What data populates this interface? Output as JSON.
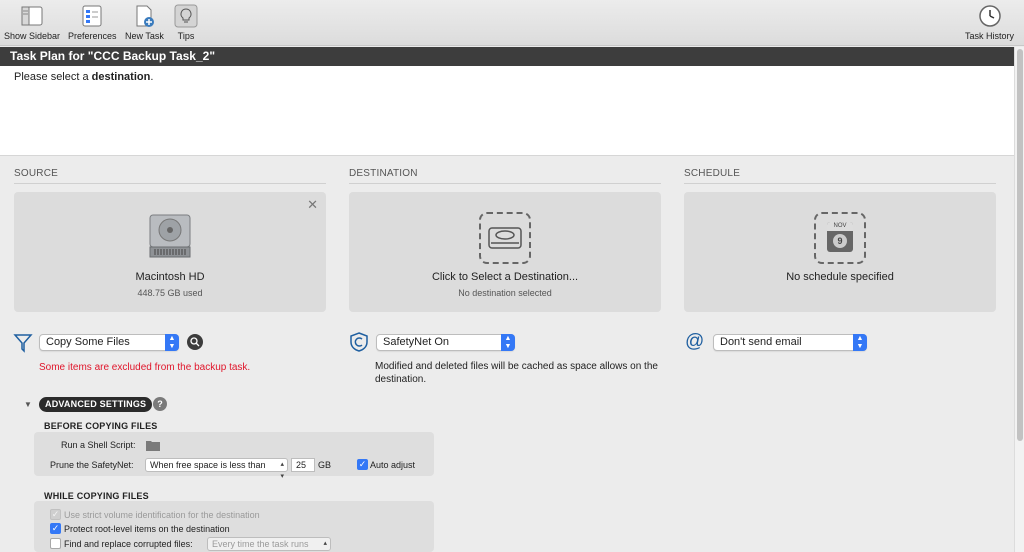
{
  "toolbar": {
    "show_sidebar": "Show Sidebar",
    "preferences": "Preferences",
    "new_task": "New Task",
    "tips": "Tips",
    "task_history": "Task History"
  },
  "title": "Task Plan for \"CCC Backup Task_2\"",
  "message": {
    "prefix": "Please select a ",
    "bold": "destination",
    "suffix": "."
  },
  "source": {
    "heading": "SOURCE",
    "disk_name": "Macintosh HD",
    "disk_used": "448.75 GB used",
    "filter_value": "Copy Some Files",
    "warning": "Some items are excluded from the backup task."
  },
  "destination": {
    "heading": "DESTINATION",
    "title": "Click to Select a Destination...",
    "subtitle": "No destination selected",
    "safetynet_value": "SafetyNet On",
    "description": "Modified and deleted files will be cached as space allows on the destination."
  },
  "schedule": {
    "heading": "SCHEDULE",
    "title": "No schedule specified",
    "calendar_month": "NOV",
    "calendar_day": "9",
    "email_value": "Don't send email"
  },
  "advanced": {
    "label": "ADVANCED SETTINGS",
    "help": "?",
    "before": {
      "heading": "BEFORE COPYING FILES",
      "shell_label": "Run a Shell Script:",
      "prune_label": "Prune the SafetyNet:",
      "prune_value": "When free space is less than",
      "prune_amount": "25",
      "prune_unit": "GB",
      "auto_adjust": "Auto adjust",
      "auto_adjust_checked": true
    },
    "while": {
      "heading": "WHILE COPYING FILES",
      "strict_label": "Use strict volume identification for the destination",
      "protect_label": "Protect root-level items on the destination",
      "find_label": "Find and replace corrupted files:",
      "find_value": "Every time the task runs"
    }
  },
  "colors": {
    "accent": "#3478f6",
    "warning": "#e0162b",
    "titlebar": "#3d3d3d"
  }
}
